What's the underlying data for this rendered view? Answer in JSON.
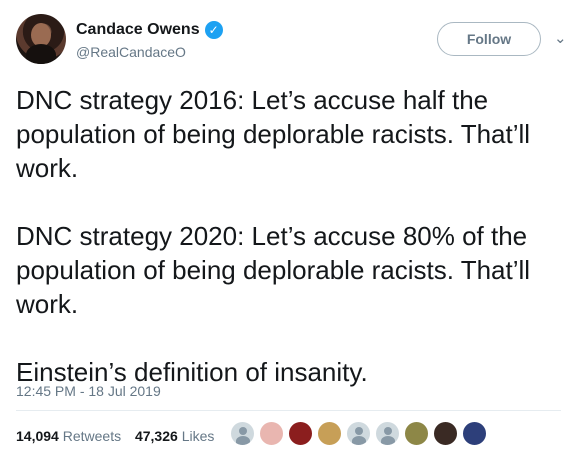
{
  "author": {
    "name": "Candace Owens",
    "handle": "@RealCandaceO",
    "verified_icon": "verified-badge-icon"
  },
  "actions": {
    "follow_label": "Follow",
    "menu_icon": "chevron-down-icon"
  },
  "tweet": {
    "text": "DNC strategy 2016: Let’s accuse half the\npopulation of being deplorable racists. That’ll\nwork.\n\nDNC strategy 2020: Let’s accuse 80% of the\npopulation of being deplorable racists. That’ll\nwork.\n\nEinstein’s definition of insanity.",
    "timestamp": "12:45 PM - 18 Jul 2019"
  },
  "stats": {
    "retweets_count": "14,094",
    "retweets_label": "Retweets",
    "likes_count": "47,326",
    "likes_label": "Likes"
  },
  "likers": [
    {
      "name": "liker-avatar-1",
      "color": "#cfd9de"
    },
    {
      "name": "liker-avatar-2",
      "color": "#e9b6b0"
    },
    {
      "name": "liker-avatar-3",
      "color": "#8b1e1e"
    },
    {
      "name": "liker-avatar-4",
      "color": "#c79f57"
    },
    {
      "name": "liker-avatar-5",
      "color": "#cfd9de"
    },
    {
      "name": "liker-avatar-6",
      "color": "#cfd9de"
    },
    {
      "name": "liker-avatar-7",
      "color": "#8d8747"
    },
    {
      "name": "liker-avatar-8",
      "color": "#3a2a24"
    },
    {
      "name": "liker-avatar-9",
      "color": "#2d3f7a"
    }
  ]
}
